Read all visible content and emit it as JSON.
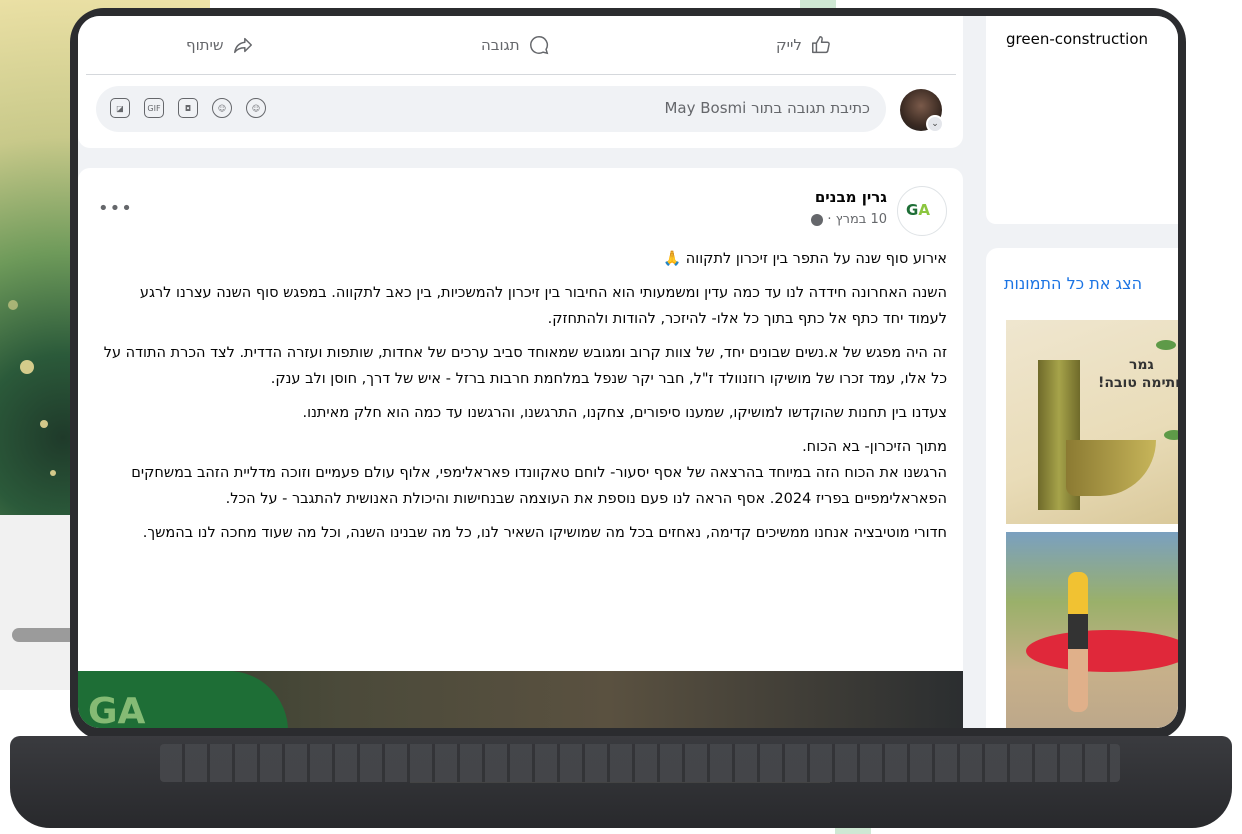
{
  "post_actions": {
    "share": "שיתוף",
    "comment": "תגובה",
    "like": "לייק"
  },
  "comment_composer": {
    "placeholder": "כתיבת תגובה בתור May Bosmi",
    "icons": [
      "sticker-icon",
      "gif-icon",
      "camera-icon",
      "emoji-icon",
      "avatar-sticker-icon"
    ]
  },
  "post": {
    "page_name": "גרין מבנים",
    "date": "10 במרץ ·",
    "paragraphs": [
      "אירוע סוף שנה על התפר בין זיכרון לתקווה 🙏",
      "השנה האחרונה חידדה לנו עד כמה עדין ומשמעותי הוא החיבור בין זיכרון להמשכיות, בין כאב לתקווה. במפגש סוף השנה עצרנו לרגע לעמוד יחד כתף אל כתף בתוך כל אלו- להיזכר, להודות ולהתחזק.",
      "זה היה מפגש של א.נשים שבונים יחד, של צוות קרוב ומגובש שמאוחד סביב ערכים של אחדות, שותפות ועזרה הדדית. לצד הכרת התודה על כל אלו, עמד זכרו של מושיקו רוזנוולד ז\"ל, חבר יקר שנפל במלחמת חרבות ברזל - איש של דרך, חוסן ולב ענק.",
      "צעדנו בין תחנות שהוקדשו למושיקו, שמענו סיפורים, צחקנו, התרגשנו, והרגשנו עד כמה הוא חלק מאיתנו.",
      "מתוך הזיכרון- בא הכוח.\nהרגשנו את הכוח הזה במיוחד בהרצאה של אסף יסעור- לוחם טאקוונדו פאראלימפי, אלוף עולם פעמיים וזוכה מדליית הזהב במשחקים הפאראלימפיים בפריז 2024. אסף הראה לנו פעם נוספת את העוצמה שבנחישות והיכולת האנושית להתגבר - על הכל.",
      "חדורי מוטיבציה אנחנו ממשיכים קדימה, נאחזים בכל מה שמושיקו השאיר לנו, כל מה שבנינו השנה, וכל מה שעוד מחכה לנו בהמשך."
    ]
  },
  "sidebar": {
    "intro_url": "green-construction",
    "photos_link": "הצג את כל התמונות",
    "photo1_text": "גמר\nחתימה טובה!"
  },
  "colors": {
    "link_blue": "#1b74e4",
    "brand_green": "#1e6e36",
    "secondary_text": "#65676b"
  }
}
